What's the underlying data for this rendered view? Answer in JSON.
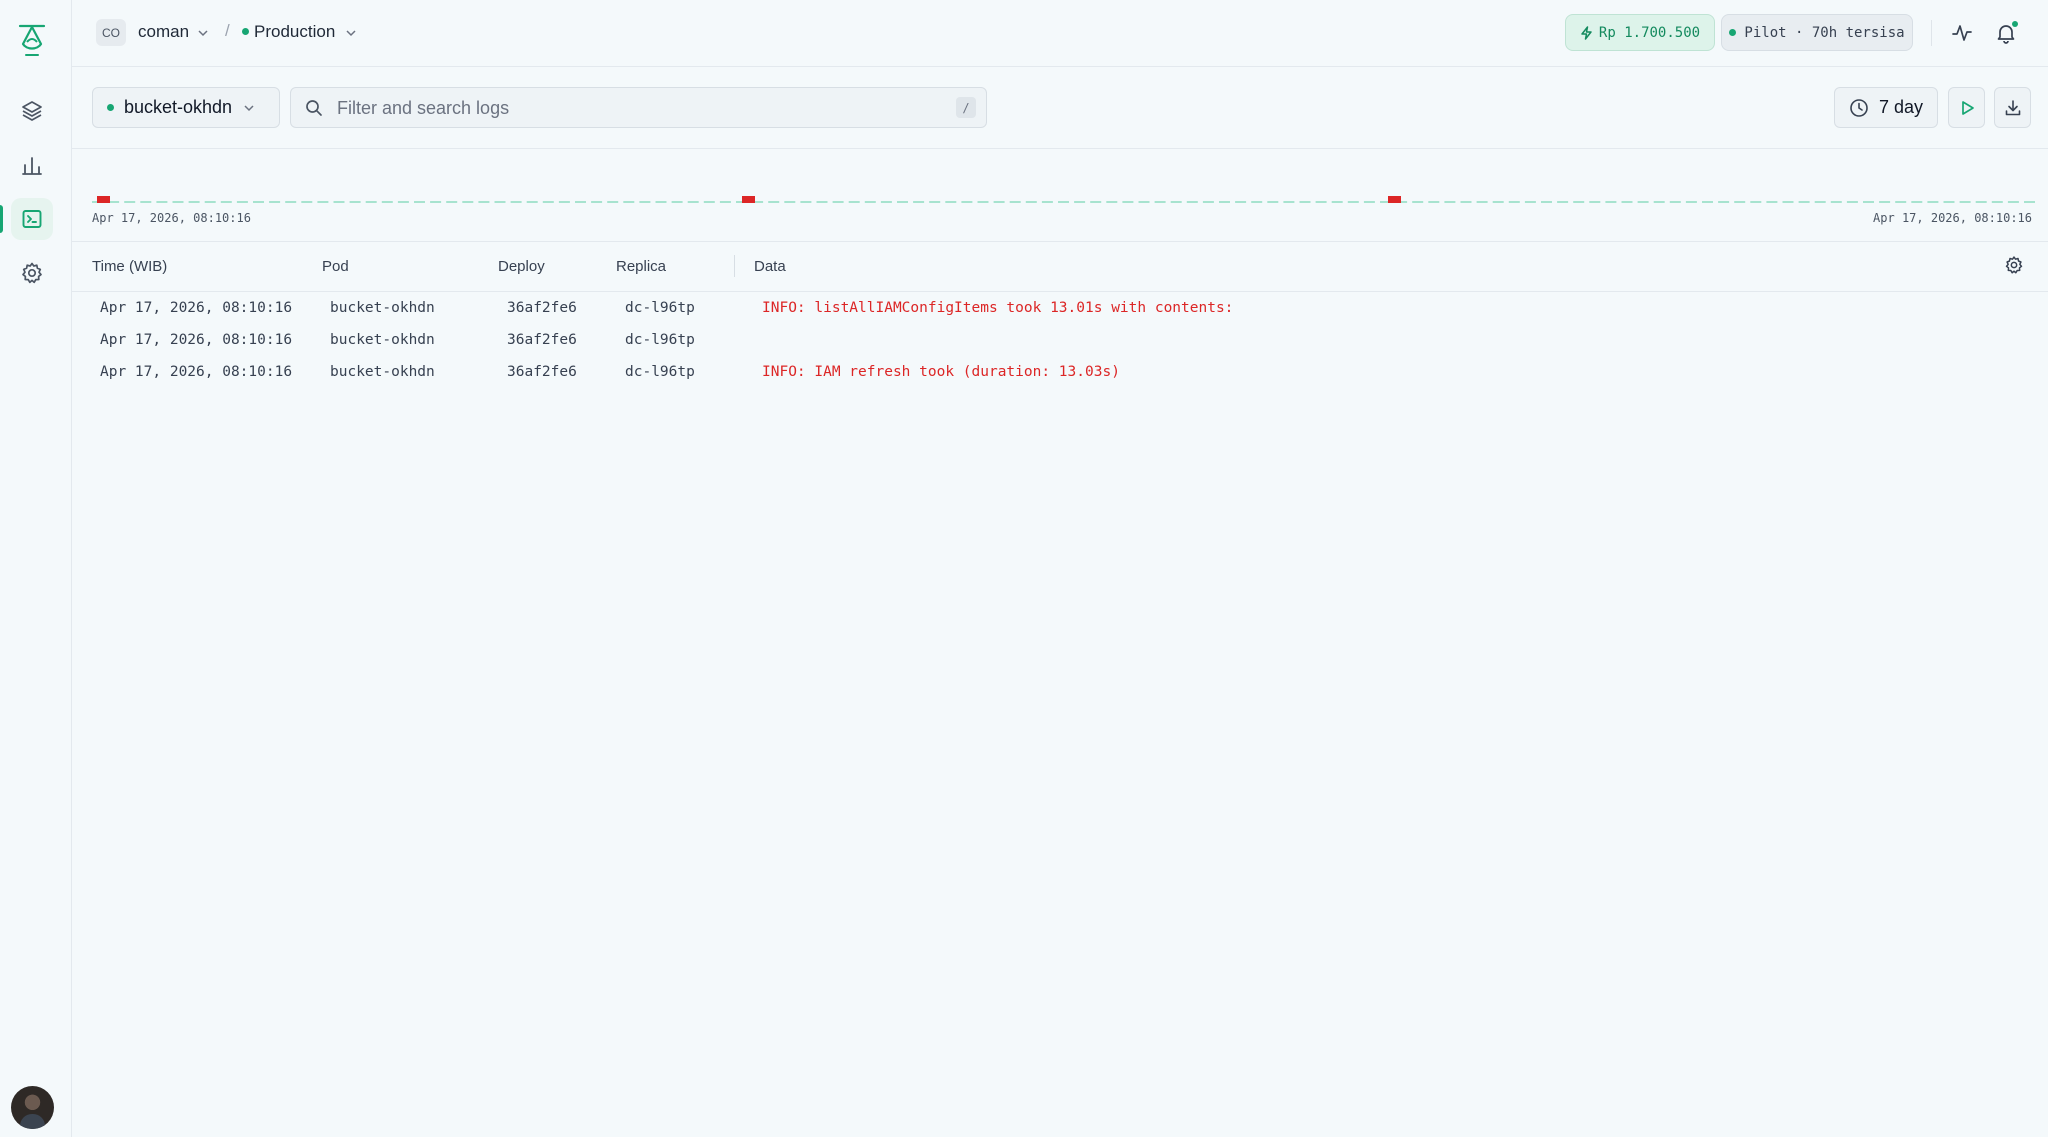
{
  "topbar": {
    "org_initials": "CO",
    "org_name": "coman",
    "separator": "/",
    "environment": "Production",
    "credit": "Rp 1.700.500",
    "plan": "Pilot · 70h tersisa"
  },
  "filters": {
    "service": "bucket-okhdn",
    "search_placeholder": "Filter and search logs",
    "search_shortcut": "/",
    "range": "7 day"
  },
  "histogram": {
    "start_label": "Apr 17, 2026, 08:10:16",
    "end_label": "Apr 17, 2026, 08:10:16",
    "colors": {
      "baseline": "#a7e3cf",
      "error": "#dc2626"
    }
  },
  "table": {
    "columns": [
      "Time (WIB)",
      "Pod",
      "Deploy",
      "Replica",
      "Data"
    ],
    "rows": [
      {
        "time": "Apr 17, 2026, 08:10:16",
        "pod": "bucket-okhdn",
        "deploy": "36af2fe6",
        "replica": "dc-l96tp",
        "data": "INFO: listAllIAMConfigItems took 13.01s with contents:"
      },
      {
        "time": "Apr 17, 2026, 08:10:16",
        "pod": "bucket-okhdn",
        "deploy": "36af2fe6",
        "replica": "dc-l96tp",
        "data": ""
      },
      {
        "time": "Apr 17, 2026, 08:10:16",
        "pod": "bucket-okhdn",
        "deploy": "36af2fe6",
        "replica": "dc-l96tp",
        "data": "INFO: IAM refresh took (duration: 13.03s)"
      }
    ]
  },
  "sidebar": {
    "items": [
      {
        "icon": "layers-icon"
      },
      {
        "icon": "bar-chart-icon"
      },
      {
        "icon": "terminal-icon",
        "active": true
      },
      {
        "icon": "gear-icon"
      }
    ]
  },
  "theme": {
    "accent": "#17a673",
    "error": "#dc2626"
  }
}
